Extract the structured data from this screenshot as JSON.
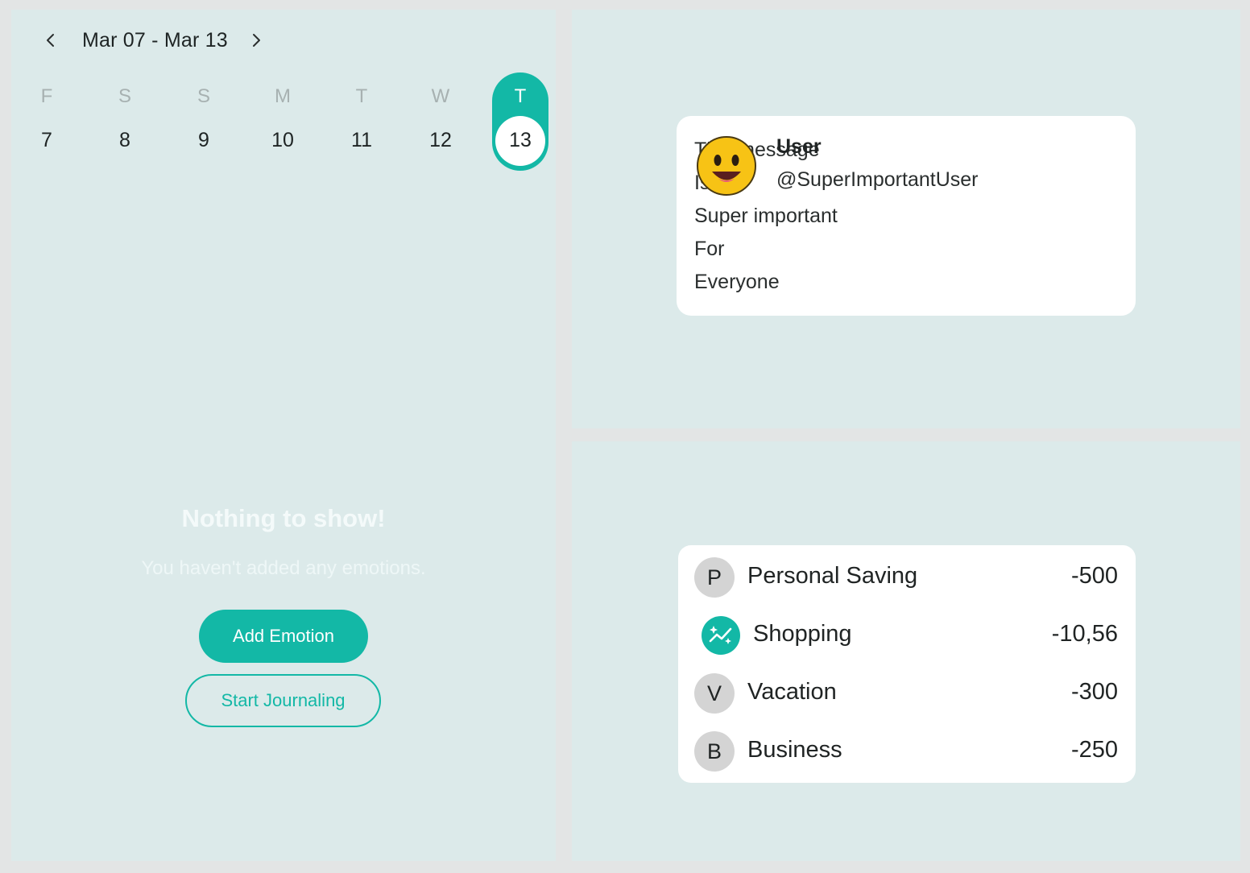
{
  "calendar": {
    "range": "Mar 07 - Mar 13",
    "prev_icon": "chevron-left-icon",
    "next_icon": "chevron-right-icon",
    "days": [
      {
        "letter": "F",
        "num": "7"
      },
      {
        "letter": "S",
        "num": "8"
      },
      {
        "letter": "S",
        "num": "9"
      },
      {
        "letter": "M",
        "num": "10"
      },
      {
        "letter": "T",
        "num": "11"
      },
      {
        "letter": "W",
        "num": "12"
      },
      {
        "letter": "T",
        "num": "13"
      }
    ],
    "selected_index": 6
  },
  "empty_state": {
    "title": "Nothing to show!",
    "subtitle": "You haven't added any emotions.",
    "add_button": "Add Emotion",
    "journal_button": "Start Journaling"
  },
  "message": {
    "lines": [
      "This message",
      "Is",
      "Super important",
      "For",
      "Everyone"
    ],
    "user_name": "User",
    "user_handle": "@SuperImportantUser",
    "avatar_icon": "smiley-face-icon"
  },
  "budget": {
    "rows": [
      {
        "badge": "P",
        "label": "Personal Saving",
        "value": "-500"
      },
      {
        "badge": "",
        "icon": "sparkle-chart-icon",
        "label": "Shopping",
        "value": "-10,56"
      },
      {
        "badge": "V",
        "label": "Vacation",
        "value": "-300"
      },
      {
        "badge": "B",
        "label": "Business",
        "value": "-250"
      }
    ]
  },
  "colors": {
    "accent": "#13b8a6",
    "panel": "#dceaea",
    "background": "#e3e5e5",
    "badge_gray": "#d4d4d4"
  }
}
